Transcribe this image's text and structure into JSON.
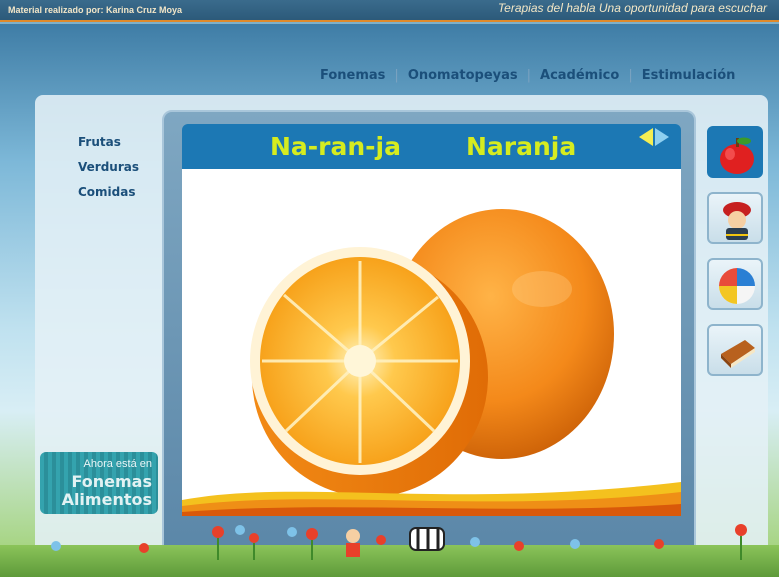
{
  "header": {
    "credit": "Material realizado por: Karina Cruz Moya",
    "tagline": "Terapias del habla Una oportunidad para escuchar"
  },
  "nav": {
    "items": [
      "Fonemas",
      "Onomatopeyas",
      "Académico",
      "Estimulación"
    ]
  },
  "sidebar": {
    "items": [
      "Frutas",
      "Verduras",
      "Comidas"
    ]
  },
  "card": {
    "syllables": "Na-ran-ja",
    "word": "Naranja",
    "image_icon": "orange-image"
  },
  "side_buttons": [
    {
      "icon": "apple-icon",
      "active": true
    },
    {
      "icon": "firefighter-icon",
      "active": false
    },
    {
      "icon": "beach-ball-icon",
      "active": false
    },
    {
      "icon": "book-icon",
      "active": false
    }
  ],
  "location": {
    "label": "Ahora está en",
    "line1": "Fonemas",
    "line2": "Alimentos"
  },
  "colors": {
    "accent_blue": "#1c78b4",
    "title_yellow": "#d6ec1f",
    "nav_text": "#1b4f7a"
  }
}
